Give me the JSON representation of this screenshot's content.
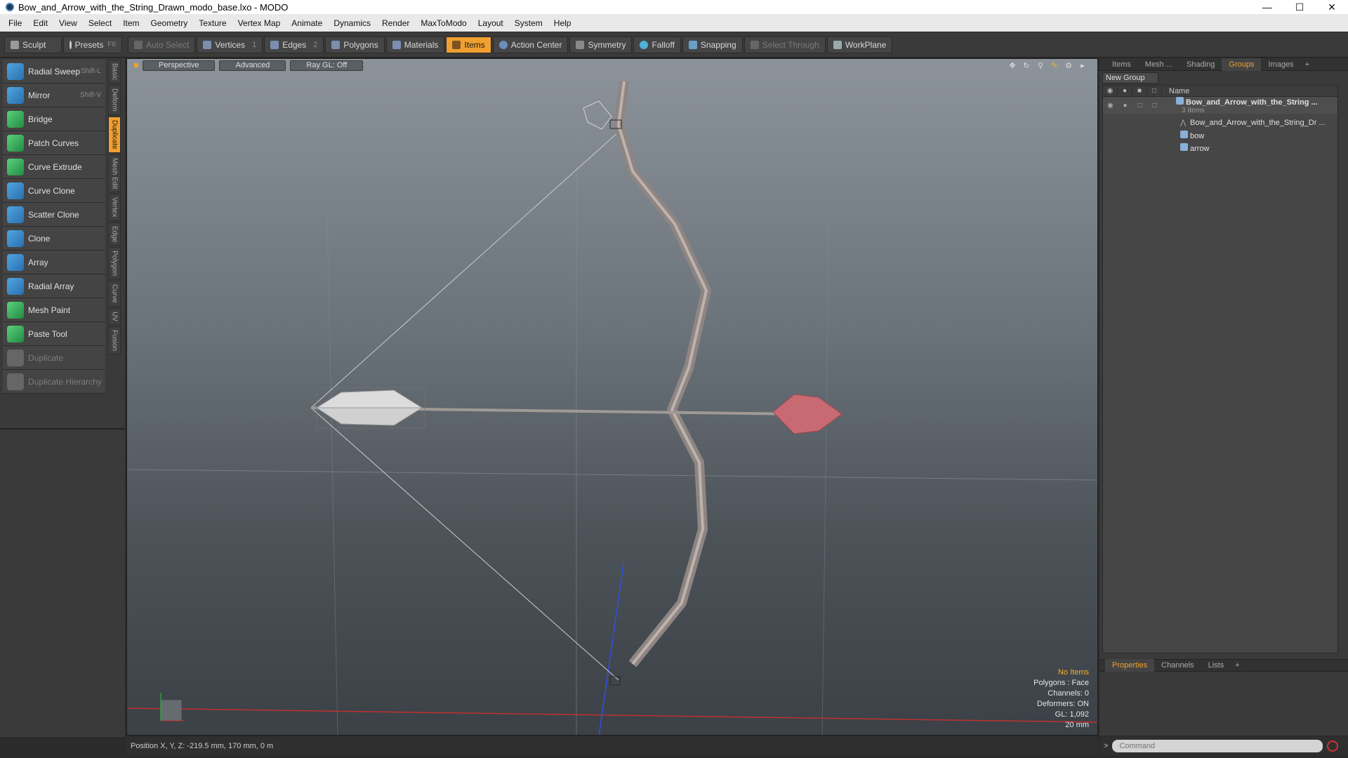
{
  "window": {
    "title": "Bow_and_Arrow_with_the_String_Drawn_modo_base.lxo - MODO"
  },
  "menubar": [
    "File",
    "Edit",
    "View",
    "Select",
    "Item",
    "Geometry",
    "Texture",
    "Vertex Map",
    "Animate",
    "Dynamics",
    "Render",
    "MaxToModo",
    "Layout",
    "System",
    "Help"
  ],
  "toolbar": {
    "sculpt": "Sculpt",
    "presets": "Presets",
    "presets_key": "F6",
    "auto_select": "Auto Select",
    "vertices": "Vertices",
    "vertices_num": "1",
    "edges": "Edges",
    "edges_num": "2",
    "polygons": "Polygons",
    "materials": "Materials",
    "items": "Items",
    "action_center": "Action Center",
    "symmetry": "Symmetry",
    "falloff": "Falloff",
    "snapping": "Snapping",
    "select_through": "Select Through",
    "workplane": "WorkPlane"
  },
  "tools": [
    {
      "label": "Radial Sweep",
      "key": "Shift-L"
    },
    {
      "label": "Mirror",
      "key": "Shift-V"
    },
    {
      "label": "Bridge",
      "key": ""
    },
    {
      "label": "Patch Curves",
      "key": ""
    },
    {
      "label": "Curve Extrude",
      "key": ""
    },
    {
      "label": "Curve Clone",
      "key": ""
    },
    {
      "label": "Scatter Clone",
      "key": ""
    },
    {
      "label": "Clone",
      "key": ""
    },
    {
      "label": "Array",
      "key": ""
    },
    {
      "label": "Radial Array",
      "key": ""
    },
    {
      "label": "Mesh Paint",
      "key": ""
    },
    {
      "label": "Paste Tool",
      "key": ""
    },
    {
      "label": "Duplicate",
      "key": ""
    },
    {
      "label": "Duplicate Hierarchy",
      "key": ""
    }
  ],
  "vtabs": [
    "Basic",
    "Deform",
    "Duplicate",
    "Mesh Edit",
    "Vertex",
    "Edge",
    "Polygon",
    "Curve",
    "UV",
    "Fusion"
  ],
  "viewport": {
    "perspective": "Perspective",
    "advanced": "Advanced",
    "raygl": "Ray GL: Off",
    "info": {
      "no_items": "No Items",
      "polygons": "Polygons : Face",
      "channels": "Channels: 0",
      "deformers": "Deformers: ON",
      "gl": "GL: 1,092",
      "scale": "20 mm"
    }
  },
  "rightpanel": {
    "tabs": [
      "Items",
      "Mesh ...",
      "Shading",
      "Groups",
      "Images"
    ],
    "new_group": "New Group",
    "name_header": "Name",
    "group_name": "Bow_and_Arrow_with_the_String ...",
    "group_count": "3 Items",
    "children": [
      "Bow_and_Arrow_with_the_String_Dr ...",
      "bow",
      "arrow"
    ],
    "prop_tabs": [
      "Properties",
      "Channels",
      "Lists"
    ]
  },
  "status": {
    "position": "Position X, Y, Z:  -219.5 mm, 170 mm, 0 m"
  },
  "command": {
    "placeholder": "Command"
  },
  "colors": {
    "accent": "#f0a030"
  }
}
